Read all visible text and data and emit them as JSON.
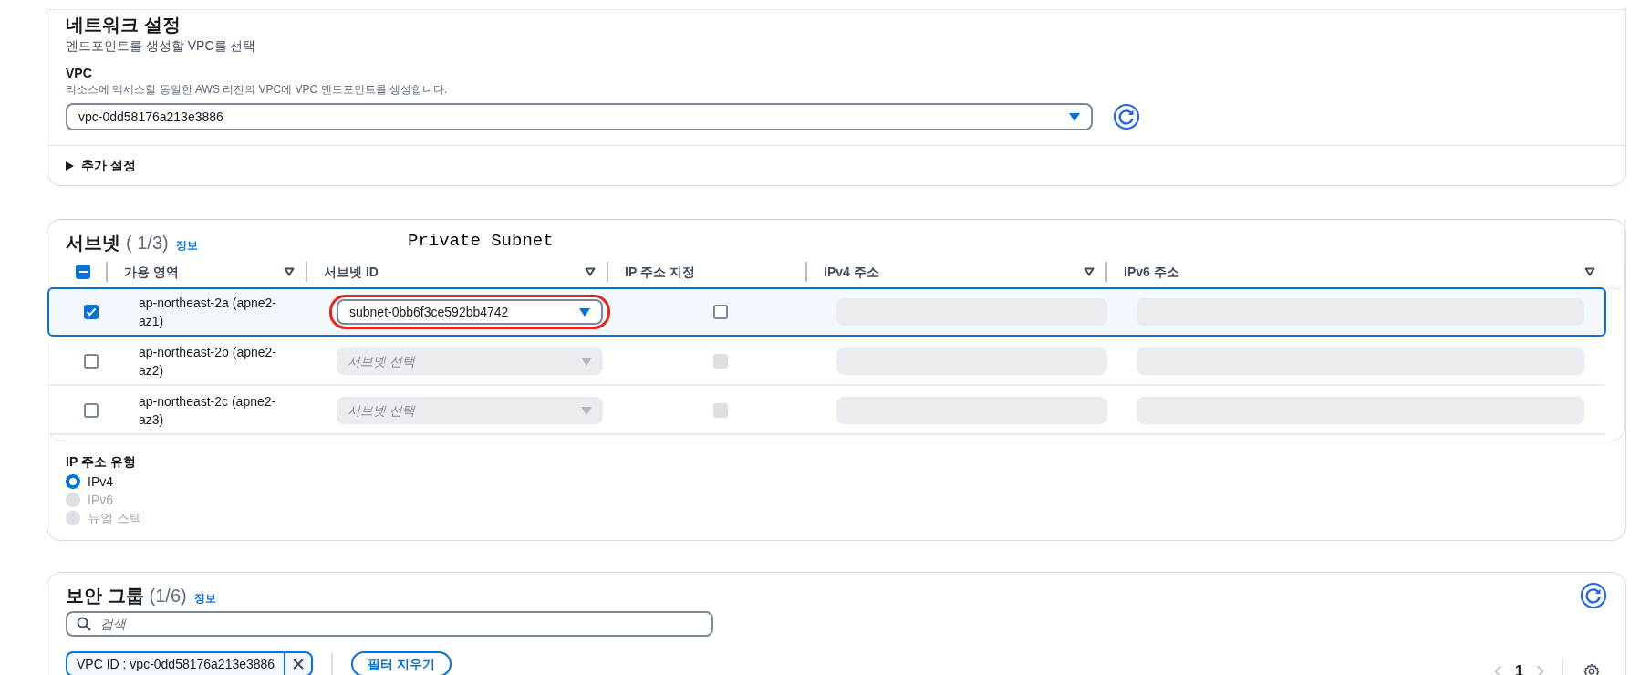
{
  "network_settings": {
    "title": "네트워크 설정",
    "description": "엔드포인트를 생성할 VPC를 선택",
    "vpc": {
      "label": "VPC",
      "description": "리소스에 액세스할 동일한 AWS 리전의 VPC에 VPC 엔드포인트를 생성합니다.",
      "value": "vpc-0dd58176a213e3886"
    },
    "additional_settings": {
      "label": "추가 설정",
      "expanded": false
    }
  },
  "subnets": {
    "title": "서브넷",
    "count": "( 1/3)",
    "info_link": "정보",
    "header_checkbox_indeterminate": true,
    "columns": [
      {
        "label": "가용 영역",
        "sortable": true
      },
      {
        "label": "서브넷 ID",
        "sortable": true
      },
      {
        "label": "IP 주소 지정",
        "sortable": false
      },
      {
        "label": "IPv4 주소",
        "sortable": true
      },
      {
        "label": "IPv6 주소",
        "sortable": true
      }
    ],
    "rows": [
      {
        "zone": "ap-northeast-2a (apne2-az1)",
        "selected": true,
        "subnet": {
          "value": "subnet-0bb6f3ce592bb4742"
        },
        "ip_checkbox_disabled": false
      },
      {
        "zone": "ap-northeast-2b (apne2-az2)",
        "selected": false,
        "subnet": {
          "placeholder": "서브넷 선택"
        },
        "ip_checkbox_disabled": true
      },
      {
        "zone": "ap-northeast-2c (apne2-az3)",
        "selected": false,
        "subnet": {
          "placeholder": "서브넷 선택"
        },
        "ip_checkbox_disabled": true
      }
    ],
    "annotation": "Private Subnet"
  },
  "ip_address_type": {
    "label": "IP 주소 유형",
    "options": [
      {
        "label": "IPv4",
        "selected": true,
        "disabled": false
      },
      {
        "label": "IPv6",
        "selected": false,
        "disabled": true
      },
      {
        "label": "듀얼 스택",
        "selected": false,
        "disabled": true
      }
    ]
  },
  "security_groups": {
    "title": "보안 그룹",
    "count": "(1/6)",
    "info_link": "정보",
    "search": {
      "placeholder": "검색"
    },
    "filter_token": "VPC ID : vpc-0dd58176a213e3886",
    "clear_filters": "필터 지우기",
    "page": "1"
  }
}
